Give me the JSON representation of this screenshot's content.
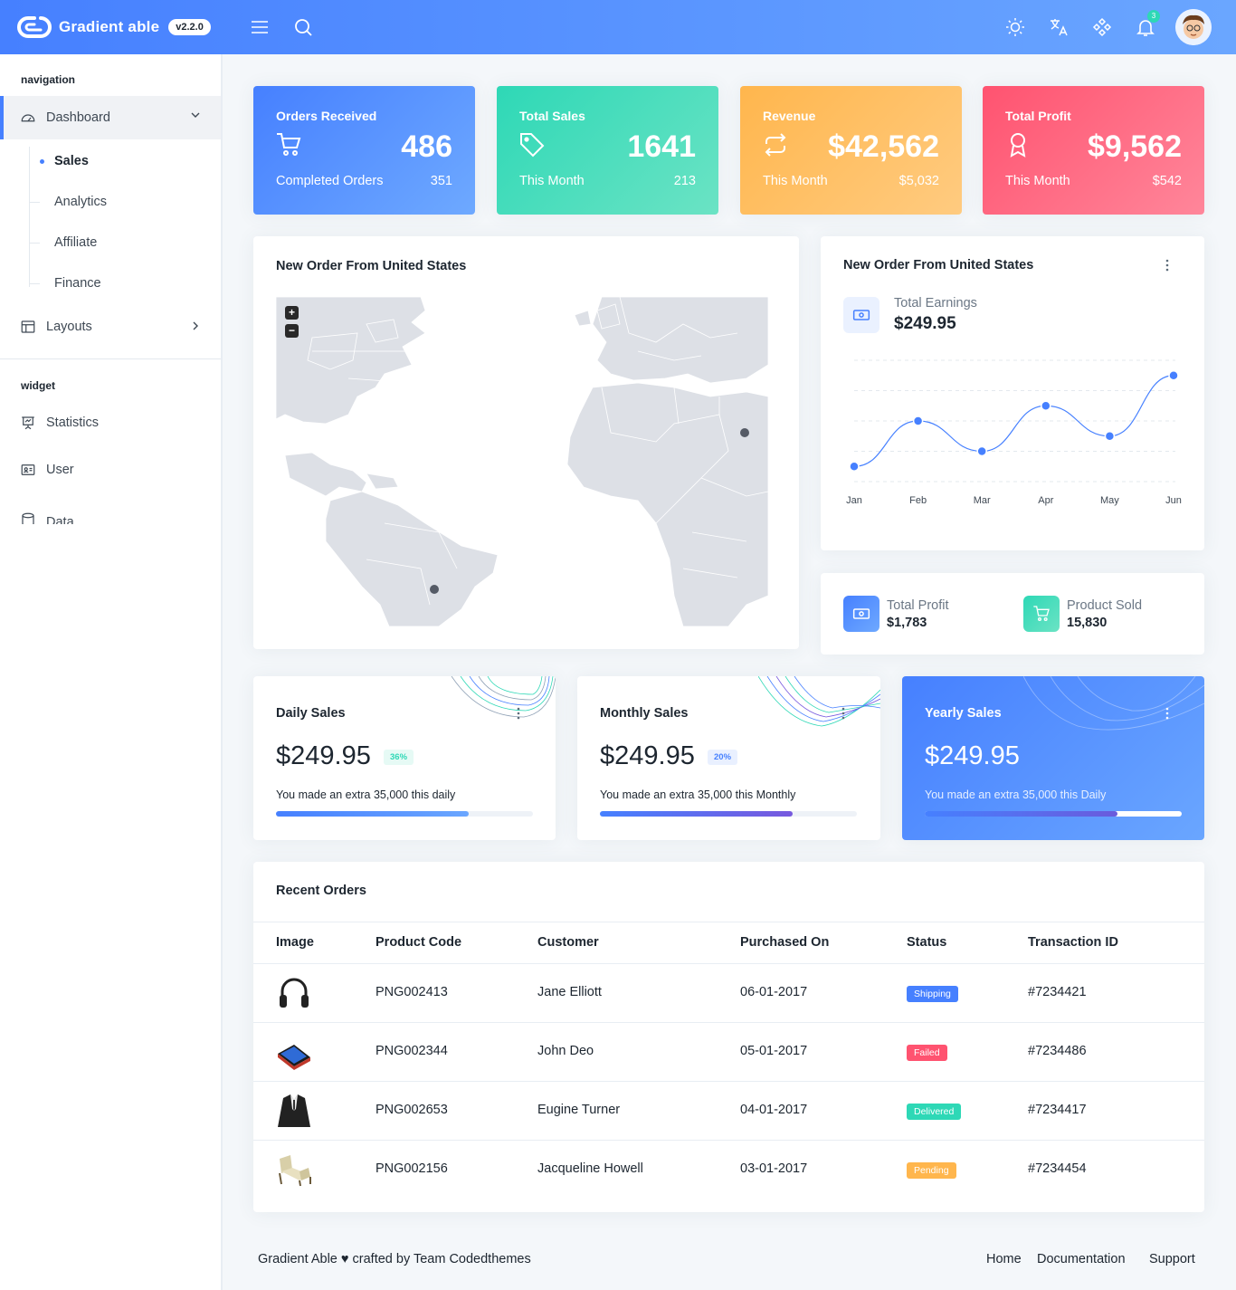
{
  "header": {
    "brand": "Gradient able",
    "version": "v2.2.0",
    "notification_count": "3",
    "icons": [
      "menu-icon",
      "search-icon",
      "sun-icon",
      "translate-icon",
      "apps-icon",
      "bell-icon"
    ]
  },
  "sidebar": {
    "caption_navigation": "navigation",
    "dashboard": "Dashboard",
    "sub_items": [
      {
        "label": "Sales",
        "active": true
      },
      {
        "label": "Analytics",
        "active": false
      },
      {
        "label": "Affiliate",
        "active": false
      },
      {
        "label": "Finance",
        "active": false
      }
    ],
    "layouts": "Layouts",
    "caption_widget": "widget",
    "widget_items": [
      "Statistics",
      "User",
      "Data"
    ]
  },
  "stats": [
    {
      "title": "Orders Received",
      "value": "486",
      "sub_label": "Completed Orders",
      "sub_value": "351",
      "icon": "cart-icon",
      "color": "#4680ff"
    },
    {
      "title": "Total Sales",
      "value": "1641",
      "sub_label": "This Month",
      "sub_value": "213",
      "icon": "tag-icon",
      "color": "#2ed8b6"
    },
    {
      "title": "Revenue",
      "value": "$42,562",
      "sub_label": "This Month",
      "sub_value": "$5,032",
      "icon": "repeat-icon",
      "color": "#ffb64d"
    },
    {
      "title": "Total Profit",
      "value": "$9,562",
      "sub_label": "This Month",
      "sub_value": "$542",
      "icon": "award-icon",
      "color": "#ff5370"
    }
  ],
  "map_card": {
    "title": "New Order From United States",
    "zoom_in": "+",
    "zoom_out": "−"
  },
  "earnings_card": {
    "title": "New Order From United States",
    "label": "Total Earnings",
    "value": "$249.95"
  },
  "chart_data": {
    "type": "line",
    "categories": [
      "Jan",
      "Feb",
      "Mar",
      "Apr",
      "May",
      "Jun"
    ],
    "values": [
      30,
      60,
      40,
      70,
      50,
      90
    ],
    "ylim": [
      20,
      100
    ],
    "grid": true,
    "color": "#4680ff"
  },
  "summary_card": {
    "profit_label": "Total Profit",
    "profit_value": "$1,783",
    "sold_label": "Product Sold",
    "sold_value": "15,830"
  },
  "sales_cards": [
    {
      "title": "Daily Sales",
      "value": "$249.95",
      "badge": "36%",
      "desc": "You made an extra 35,000 this daily",
      "progress": 0.75
    },
    {
      "title": "Monthly Sales",
      "value": "$249.95",
      "badge": "20%",
      "desc": "You made an extra 35,000 this Monthly",
      "progress": 0.75
    },
    {
      "title": "Yearly Sales",
      "value": "$249.95",
      "desc": "You made an extra 35,000 this Daily",
      "progress": 0.75
    }
  ],
  "orders": {
    "title": "Recent Orders",
    "columns": [
      "Image",
      "Product Code",
      "Customer",
      "Purchased On",
      "Status",
      "Transaction ID"
    ],
    "rows": [
      {
        "image": "headphones-image",
        "code": "PNG002413",
        "customer": "Jane Elliott",
        "date": "06-01-2017",
        "status": "Shipping",
        "status_color": "#4680ff",
        "txn": "#7234421"
      },
      {
        "image": "phone-image",
        "code": "PNG002344",
        "customer": "John Deo",
        "date": "05-01-2017",
        "status": "Failed",
        "status_color": "#ff5370",
        "txn": "#7234486"
      },
      {
        "image": "suit-image",
        "code": "PNG002653",
        "customer": "Eugine Turner",
        "date": "04-01-2017",
        "status": "Delivered",
        "status_color": "#2ed8b6",
        "txn": "#7234417"
      },
      {
        "image": "chair-image",
        "code": "PNG002156",
        "customer": "Jacqueline Howell",
        "date": "03-01-2017",
        "status": "Pending",
        "status_color": "#ffb64d",
        "txn": "#7234454"
      }
    ]
  },
  "footer": {
    "credit": "Gradient Able ♥ crafted by Team Codedthemes",
    "links": [
      "Home",
      "Documentation",
      "Support"
    ]
  }
}
